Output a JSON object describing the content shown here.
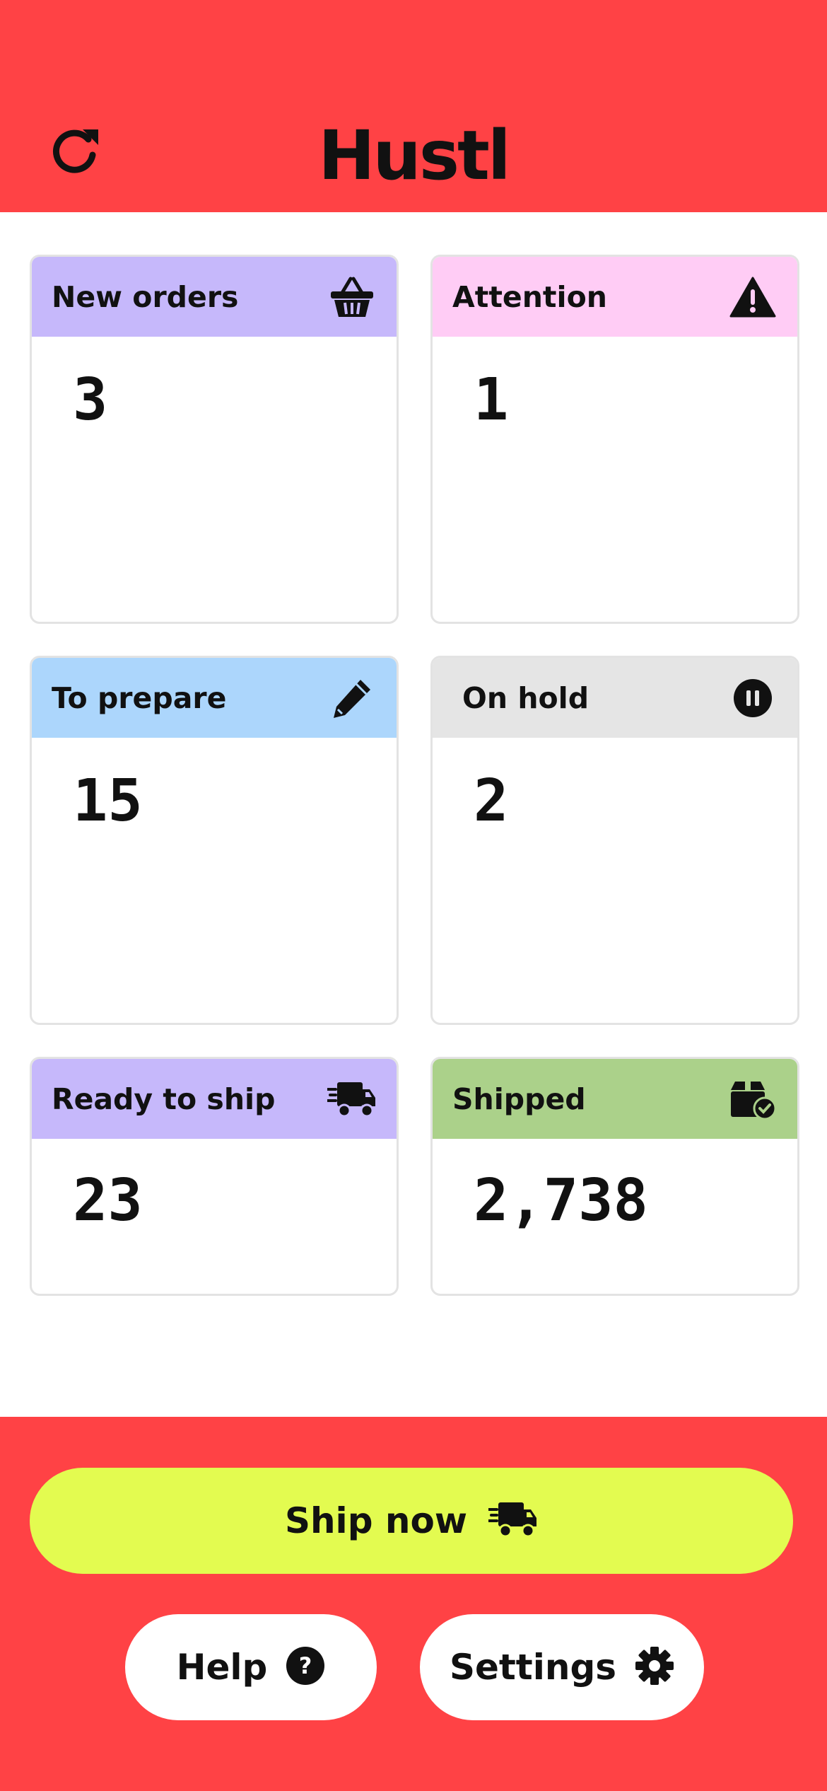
{
  "app": {
    "logo_text": "Hustl",
    "refresh_icon": "refresh-icon"
  },
  "colors": {
    "brand_red": "#ff4245",
    "ship_button": "#e3fb50",
    "lavender": "#c6b8fb",
    "pink": "#ffccf5",
    "light_blue": "#acd6fc",
    "light_gray": "#e5e5e5",
    "green": "#abd18a"
  },
  "cards": [
    {
      "title": "New orders",
      "value": "3",
      "icon": "basket-icon",
      "color": "#c6b8fb"
    },
    {
      "title": "Attention",
      "value": "1",
      "icon": "warning-icon",
      "color": "#ffccf5"
    },
    {
      "title": "To prepare",
      "value": "15",
      "icon": "pencil-icon",
      "color": "#acd6fc"
    },
    {
      "title": "On hold",
      "value": "2",
      "icon": "pause-icon",
      "color": "#e5e5e5"
    },
    {
      "title": "Ready to ship",
      "value": "23",
      "icon": "truck-icon",
      "color": "#c6b8fb"
    },
    {
      "title": "Shipped",
      "value": "2,738",
      "icon": "box-check-icon",
      "color": "#abd18a"
    }
  ],
  "actions": {
    "ship_now_label": "Ship now",
    "help_label": "Help",
    "settings_label": "Settings"
  }
}
